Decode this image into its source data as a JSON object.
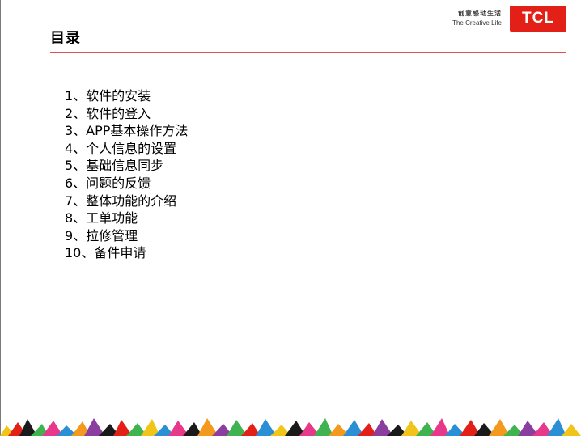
{
  "slide": {
    "title": "目录",
    "brand": {
      "slogan_cn": "创意感动生活",
      "slogan_en": "The Creative Life",
      "logo_text": "TCL",
      "logo_color": "#e32017"
    },
    "toc": [
      "1、软件的安装",
      "2、软件的登入",
      "3、APP基本操作方法",
      "4、个人信息的设置",
      "5、基础信息同步",
      "6、问题的反馈",
      "7、整体功能的介绍",
      "8、工单功能",
      "9、拉修管理",
      "10、备件申请"
    ],
    "accent_color": "#e05050"
  }
}
